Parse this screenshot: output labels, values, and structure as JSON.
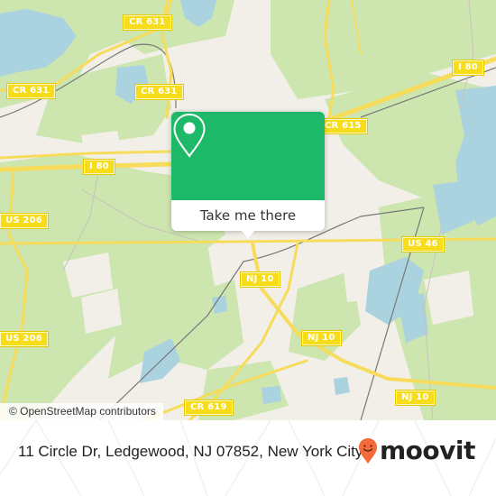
{
  "map": {
    "road_labels": [
      {
        "id": "cr631-top",
        "text": "CR 631"
      },
      {
        "id": "cr631-left",
        "text": "CR 631"
      },
      {
        "id": "cr631-mid",
        "text": "CR 631"
      },
      {
        "id": "i80-right",
        "text": "I 80"
      },
      {
        "id": "cr615",
        "text": "CR 615"
      },
      {
        "id": "i80-left",
        "text": "I 80"
      },
      {
        "id": "us206-top",
        "text": "US 206"
      },
      {
        "id": "us46",
        "text": "US 46"
      },
      {
        "id": "nj10-a",
        "text": "NJ 10"
      },
      {
        "id": "us206-bottom",
        "text": "US 206"
      },
      {
        "id": "nj10-b",
        "text": "NJ 10"
      },
      {
        "id": "nj10-c",
        "text": "NJ 10"
      },
      {
        "id": "cr619",
        "text": "CR 619"
      }
    ],
    "attribution": "© OpenStreetMap contributors",
    "colors": {
      "land": "#f2efe9",
      "forest": "#cde6b0",
      "water": "#aad3df",
      "road": "#f7dc5c",
      "rail": "#777777"
    }
  },
  "popup": {
    "icon": "map-pin-icon",
    "button_label": "Take me there",
    "accent_color": "#1db868"
  },
  "footer": {
    "address": "11 Circle Dr, Ledgewood, NJ 07852, New York City",
    "brand_name": "moovit",
    "brand_icon": "moovit-smile-pin-icon",
    "brand_color": "#f26b3a"
  }
}
